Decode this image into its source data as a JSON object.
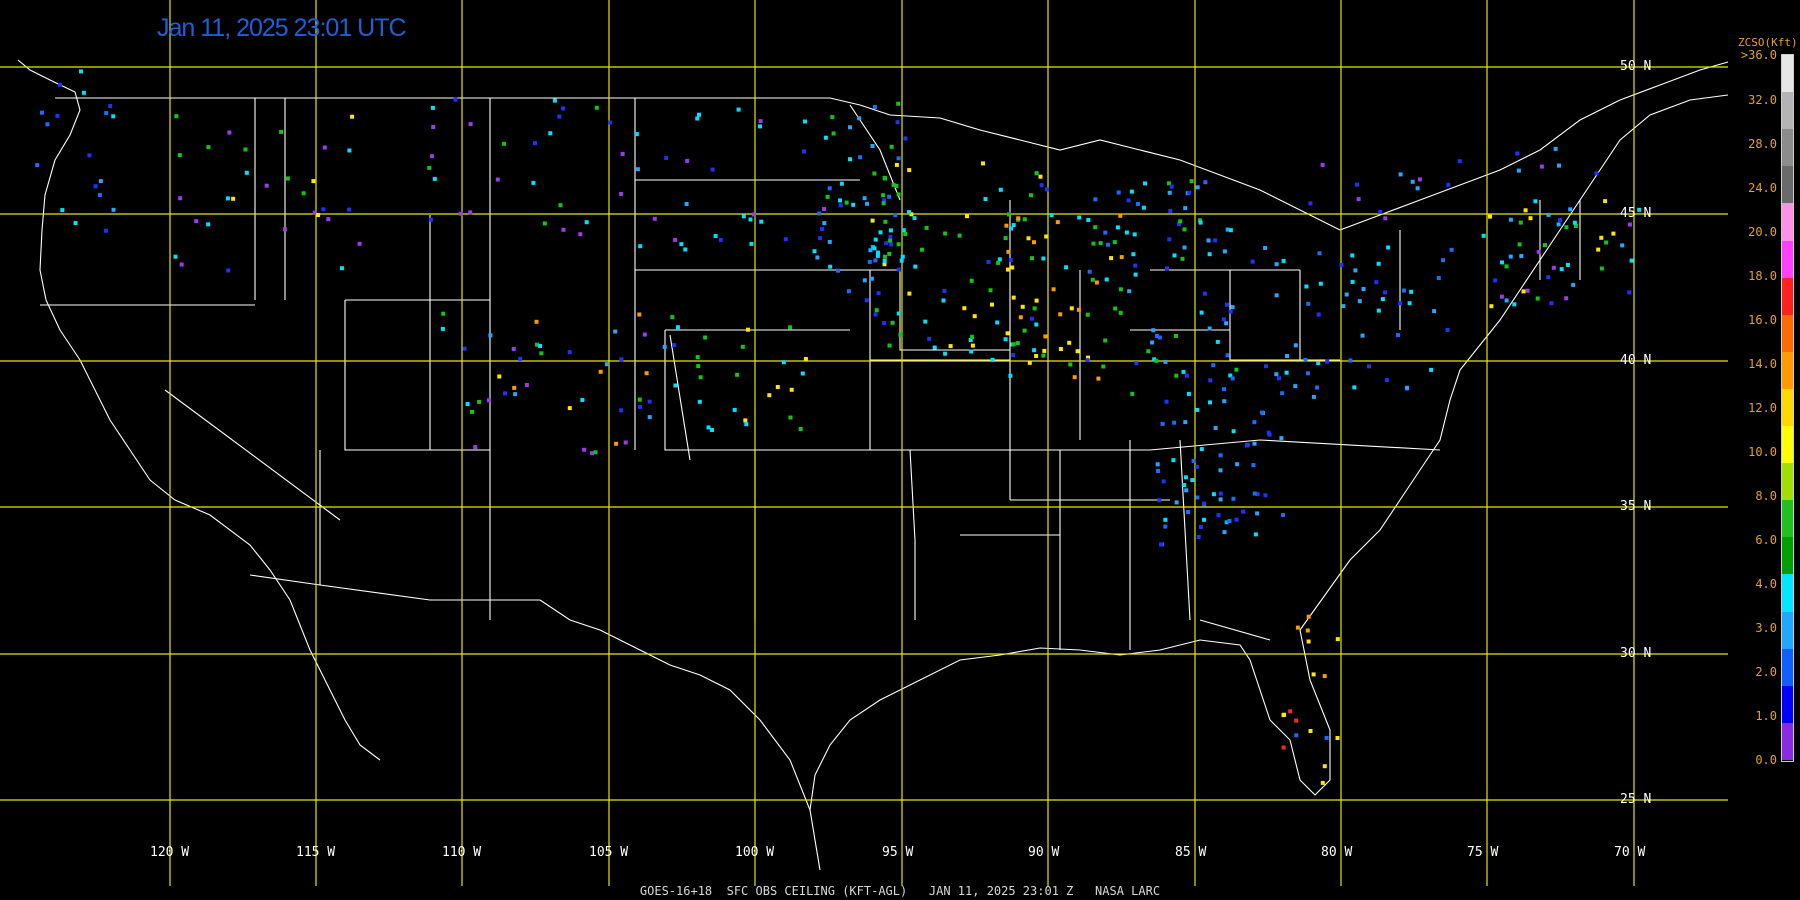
{
  "title": "Jan 11, 2025 23:01 UTC",
  "footer": "GOES-16+18  SFC OBS CEILING (KFT-AGL)   JAN 11, 2025 23:01 Z   NASA LARC",
  "colorbar": {
    "title": "ZCSO(Kft)",
    "ticks": [
      ">36.0",
      "32.0",
      "28.0",
      "24.0",
      "20.0",
      "18.0",
      "16.0",
      "14.0",
      "12.0",
      "10.0",
      "8.0",
      "6.0",
      "4.0",
      "3.0",
      "2.0",
      "1.0",
      "0.0"
    ],
    "colors": [
      "#e6e6e6",
      "#b4b4b4",
      "#8c8c8c",
      "#6a6a6a",
      "#ff90e8",
      "#ff40ff",
      "#ff2020",
      "#ff6a00",
      "#ff9a00",
      "#ffd800",
      "#ffff00",
      "#a0e000",
      "#20c020",
      "#00a000",
      "#00e8ff",
      "#20a8ff",
      "#1060ff",
      "#0000ff",
      "#8a2be2"
    ]
  },
  "grid": {
    "lat_labels": [
      "50 N",
      "45 N",
      "40 N",
      "35 N",
      "30 N",
      "25 N"
    ],
    "lon_labels": [
      "120 W",
      "115 W",
      "110 W",
      "105 W",
      "100 W",
      "95 W",
      "90 W",
      "85 W",
      "80 W",
      "75 W",
      "70 W"
    ],
    "grid_color": "#e6e600"
  },
  "stations": {
    "purple": "#9b3bf0",
    "blue": "#1e32ff",
    "medium_blue": "#1a6cff",
    "sky": "#26a6ff",
    "cyan": "#00e0ff",
    "green": "#10c810",
    "yellow": "#ffe600",
    "orange": "#ff9900",
    "red": "#ff2a1a"
  }
}
